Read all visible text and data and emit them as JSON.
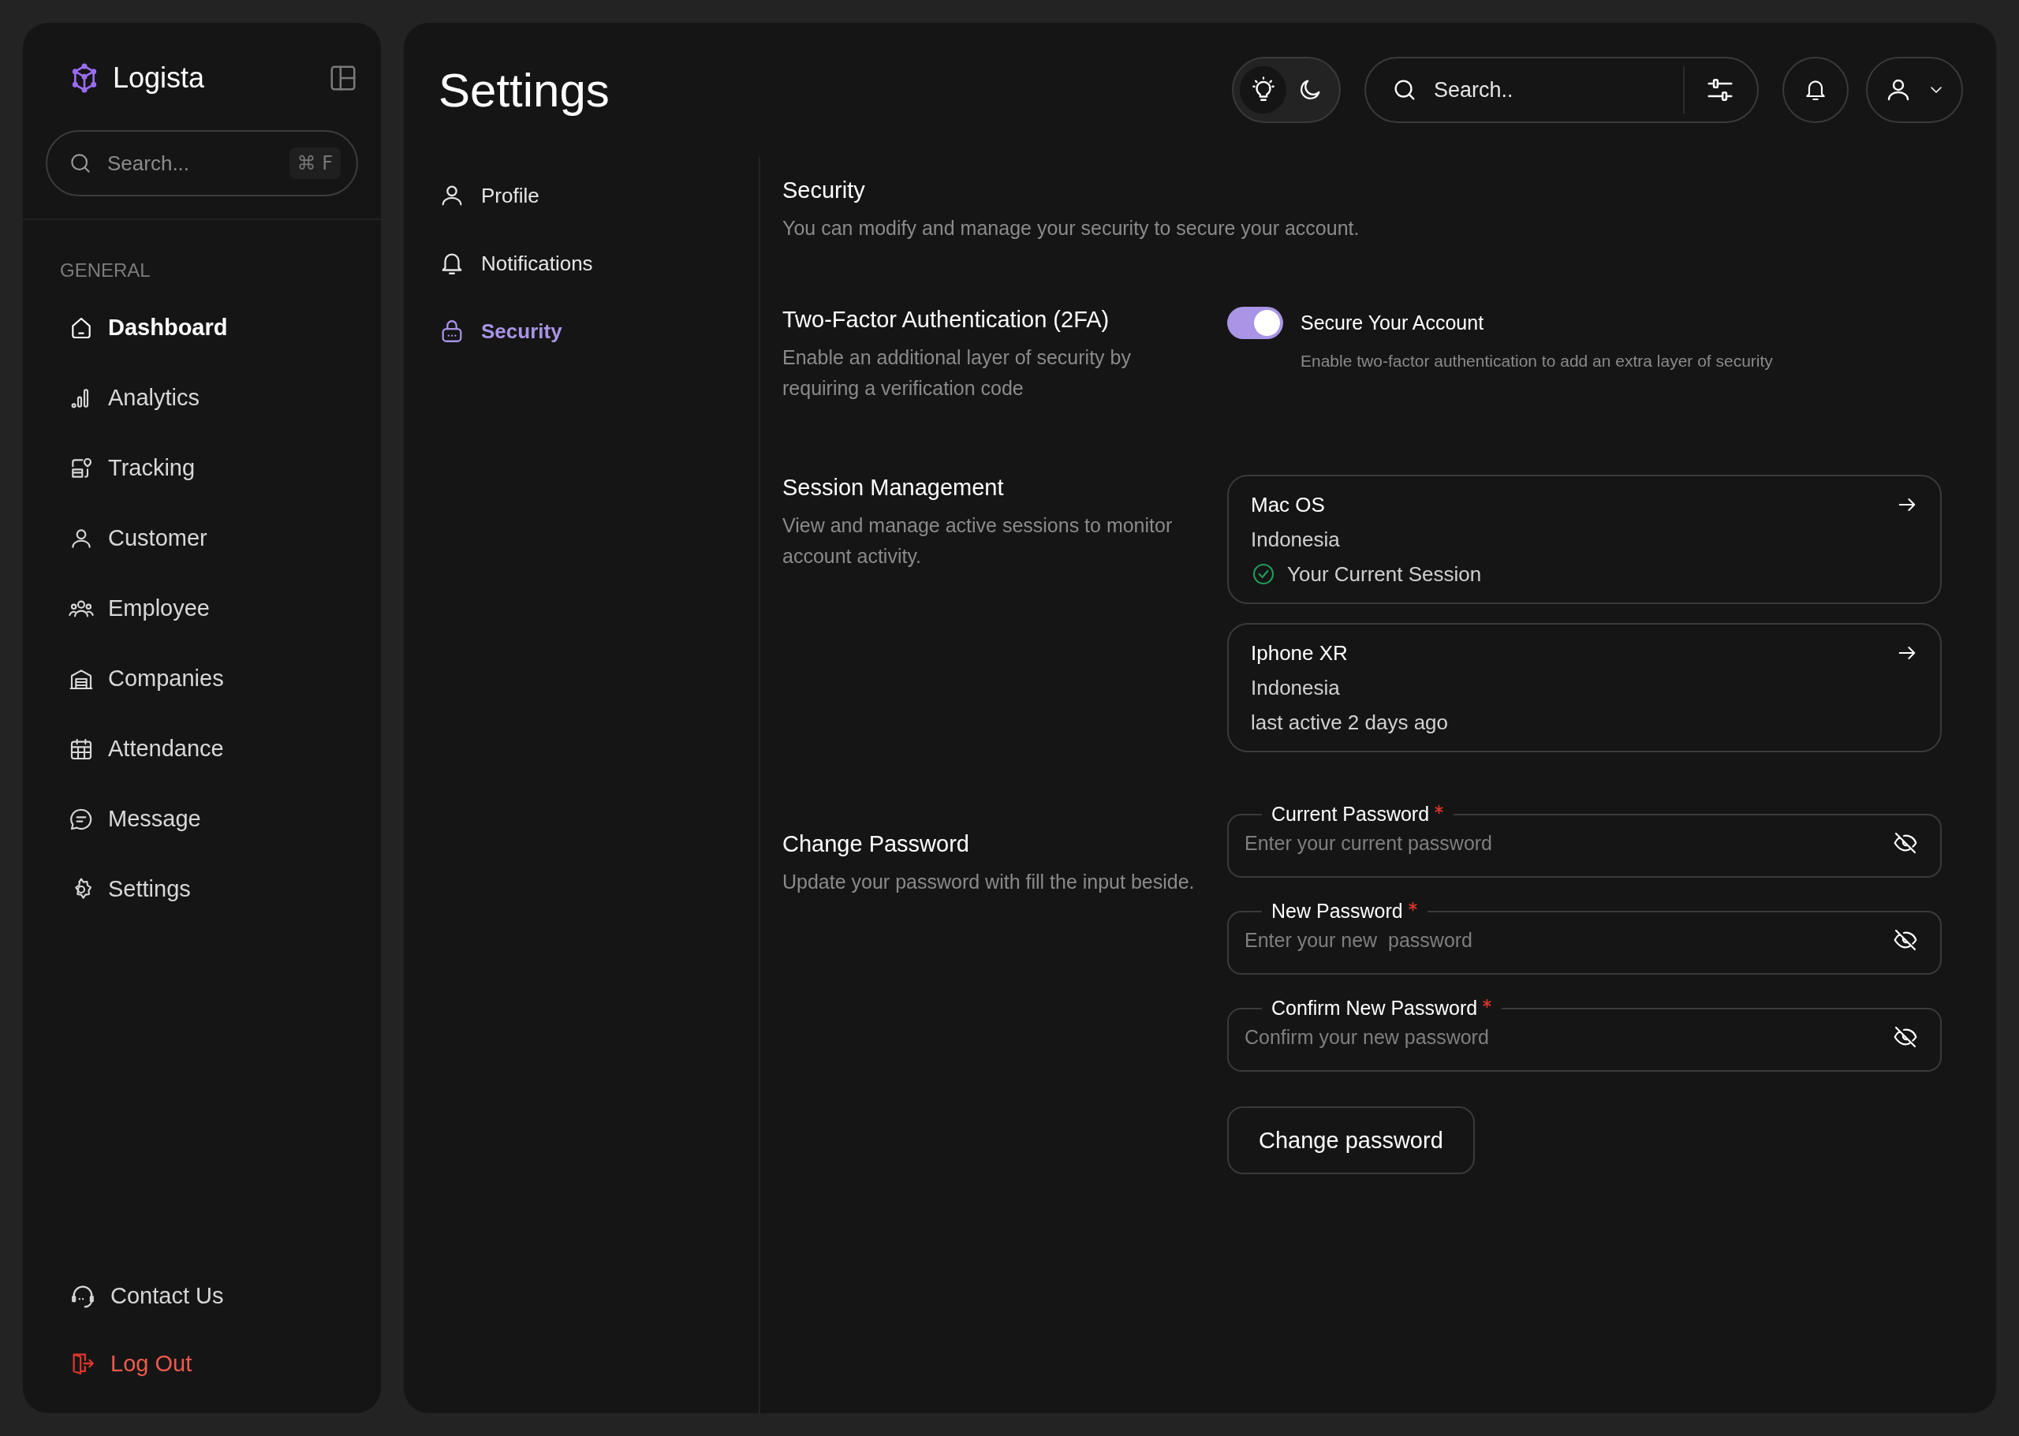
{
  "sidebar": {
    "brand": "Logista",
    "search": {
      "placeholder": "Search...",
      "shortcut": "⌘ F"
    },
    "section_label": "GENERAL",
    "items": [
      {
        "label": "Dashboard",
        "selected": true
      },
      {
        "label": "Analytics",
        "selected": false
      },
      {
        "label": "Tracking",
        "selected": false
      },
      {
        "label": "Customer",
        "selected": false
      },
      {
        "label": "Employee",
        "selected": false
      },
      {
        "label": "Companies",
        "selected": false
      },
      {
        "label": "Attendance",
        "selected": false
      },
      {
        "label": "Message",
        "selected": false
      },
      {
        "label": "Settings",
        "selected": false
      }
    ],
    "footer": [
      {
        "label": "Contact Us",
        "kind": "default"
      },
      {
        "label": "Log Out",
        "kind": "danger"
      }
    ]
  },
  "header": {
    "title": "Settings",
    "theme_options": [
      {
        "selected": true
      },
      {
        "selected": false
      }
    ],
    "search": {
      "placeholder": "Search.."
    }
  },
  "settings_nav": [
    {
      "label": "Profile",
      "selected": false
    },
    {
      "label": "Notifications",
      "selected": false
    },
    {
      "label": "Security",
      "selected": true
    }
  ],
  "security": {
    "title": "Security",
    "description": "You can modify and manage your security to secure your account.",
    "two_factor": {
      "title": "Two-Factor Authentication (2FA)",
      "description": "Enable an additional layer of security by requiring a verification code",
      "toggle": {
        "on": true,
        "label": "Secure Your Account",
        "description": "Enable two-factor authentication to add an extra layer of security"
      }
    },
    "sessions": {
      "title": "Session Management",
      "description": "View and manage active sessions to monitor account activity.",
      "items": [
        {
          "device": "Mac OS",
          "location": "Indonesia",
          "status": "Your Current Session",
          "current": true
        },
        {
          "device": "Iphone XR",
          "location": "Indonesia",
          "status": "last active 2 days ago",
          "current": false
        }
      ]
    },
    "change_password": {
      "title": "Change Password",
      "description": "Update your password with fill the input beside.",
      "fields": [
        {
          "label": "Current Password",
          "required": true,
          "placeholder": "Enter your current password"
        },
        {
          "label": "New Password",
          "required": true,
          "placeholder": "Enter your new  password"
        },
        {
          "label": "Confirm New Password",
          "required": true,
          "placeholder": "Confirm your new password"
        }
      ],
      "button": "Change password"
    }
  }
}
